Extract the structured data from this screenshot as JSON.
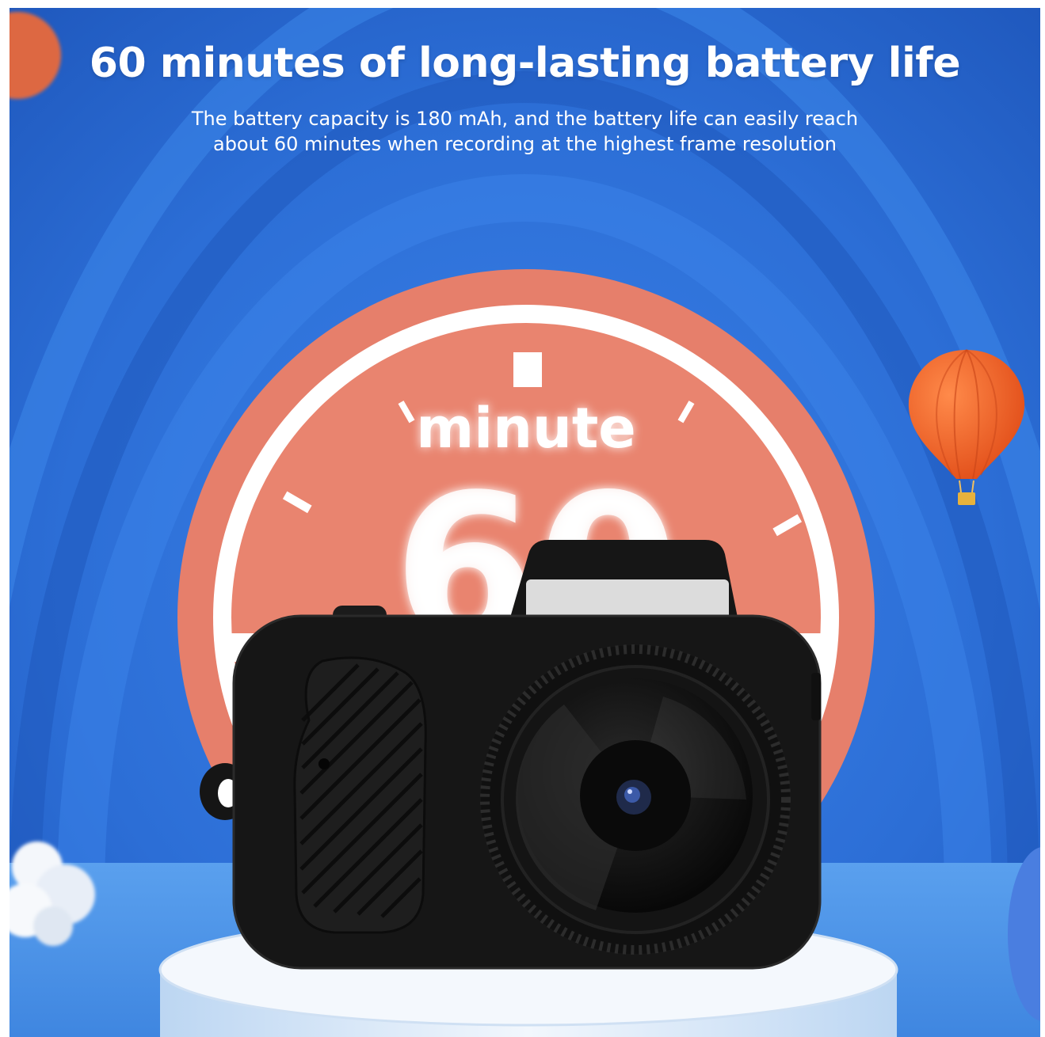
{
  "headline": "60 minutes of long-lasting battery life",
  "subtitle": {
    "line1": "The battery capacity is 180 mAh, and the battery life can easily reach",
    "line2": "about 60 minutes when recording at the highest frame resolution"
  },
  "dial": {
    "word": "minute",
    "number": "60"
  },
  "colors": {
    "background_blue": "#2d6fd6",
    "dial_coral": "#e8826f",
    "camera_black": "#151515",
    "balloon_orange": "#f0642a"
  },
  "icons": [
    "camera-icon",
    "hot-air-balloon-icon",
    "clock-dial-icon"
  ]
}
